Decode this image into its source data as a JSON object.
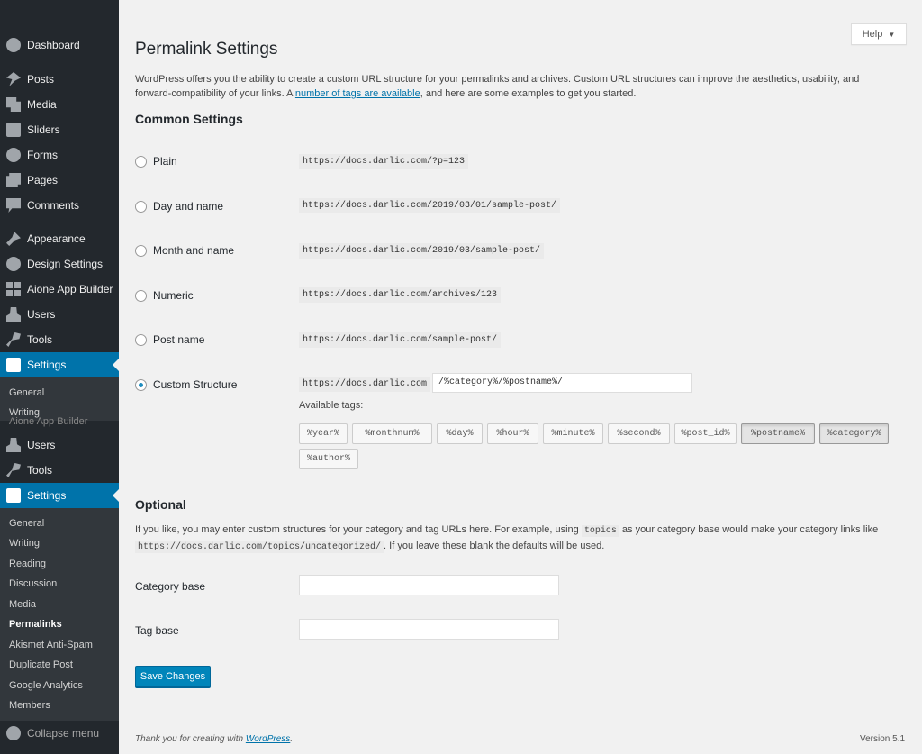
{
  "sidebar": {
    "top_items": [
      {
        "label": "Dashboard",
        "icon": "dashboard-icon"
      },
      {
        "label": "Posts",
        "icon": "pin-icon"
      },
      {
        "label": "Media",
        "icon": "media-icon"
      },
      {
        "label": "Sliders",
        "icon": "slider-icon"
      },
      {
        "label": "Forms",
        "icon": "forms-icon"
      },
      {
        "label": "Pages",
        "icon": "pages-icon"
      },
      {
        "label": "Comments",
        "icon": "comments-icon"
      },
      {
        "label": "Appearance",
        "icon": "brush-icon"
      },
      {
        "label": "Design Settings",
        "icon": "design-icon"
      },
      {
        "label": "Aione App Builder",
        "icon": "grid-icon"
      },
      {
        "label": "Users",
        "icon": "user-icon"
      },
      {
        "label": "Tools",
        "icon": "wrench-icon"
      },
      {
        "label": "Settings",
        "icon": "settings-icon"
      }
    ],
    "flyout": {
      "items": [
        "General",
        "Writing"
      ],
      "overlap_label": "Aione App Builder"
    },
    "lower_items": [
      {
        "label": "Users",
        "icon": "user-icon"
      },
      {
        "label": "Tools",
        "icon": "wrench-icon"
      },
      {
        "label": "Settings",
        "icon": "settings-icon"
      }
    ],
    "submenu": [
      "General",
      "Writing",
      "Reading",
      "Discussion",
      "Media",
      "Permalinks",
      "Akismet Anti-Spam",
      "Duplicate Post",
      "Google Analytics",
      "Members"
    ],
    "current_submenu": "Permalinks",
    "collapse_label": "Collapse menu"
  },
  "header": {
    "help_label": "Help",
    "title": "Permalink Settings"
  },
  "intro": {
    "text_before": "WordPress offers you the ability to create a custom URL structure for your permalinks and archives. Custom URL structures can improve the aesthetics, usability, and forward-compatibility of your links. A ",
    "link_text": "number of tags are available",
    "text_after": ", and here are some examples to get you started."
  },
  "common": {
    "heading": "Common Settings",
    "options": [
      {
        "label": "Plain",
        "example": "https://docs.darlic.com/?p=123",
        "selected": false
      },
      {
        "label": "Day and name",
        "example": "https://docs.darlic.com/2019/03/01/sample-post/",
        "selected": false
      },
      {
        "label": "Month and name",
        "example": "https://docs.darlic.com/2019/03/sample-post/",
        "selected": false
      },
      {
        "label": "Numeric",
        "example": "https://docs.darlic.com/archives/123",
        "selected": false
      },
      {
        "label": "Post name",
        "example": "https://docs.darlic.com/sample-post/",
        "selected": false
      },
      {
        "label": "Custom Structure",
        "example": "https://docs.darlic.com",
        "selected": true
      }
    ],
    "custom_value": "/%category%/%postname%/",
    "available_label": "Available tags:",
    "tags": [
      {
        "label": "%year%",
        "pressed": false
      },
      {
        "label": "%monthnum%",
        "pressed": false
      },
      {
        "label": "%day%",
        "pressed": false
      },
      {
        "label": "%hour%",
        "pressed": false
      },
      {
        "label": "%minute%",
        "pressed": false
      },
      {
        "label": "%second%",
        "pressed": false
      },
      {
        "label": "%post_id%",
        "pressed": false
      },
      {
        "label": "%postname%",
        "pressed": true
      },
      {
        "label": "%category%",
        "pressed": true
      },
      {
        "label": "%author%",
        "pressed": false
      }
    ]
  },
  "optional": {
    "heading": "Optional",
    "text1": "If you like, you may enter custom structures for your category and tag URLs here. For example, using ",
    "code1": "topics",
    "text2": " as your category base would make your category links like ",
    "code2": "https://docs.darlic.com/topics/uncategorized/",
    "text3": ". If you leave these blank the defaults will be used.",
    "category_label": "Category base",
    "category_value": "",
    "tag_label": "Tag base",
    "tag_value": ""
  },
  "save_label": "Save Changes",
  "footer": {
    "text": "Thank you for creating with ",
    "link": "WordPress",
    "period": ".",
    "version": "Version 5.1"
  },
  "colors": {
    "sidebar_bg": "#23282d",
    "active": "#0073aa",
    "button": "#0085ba"
  }
}
